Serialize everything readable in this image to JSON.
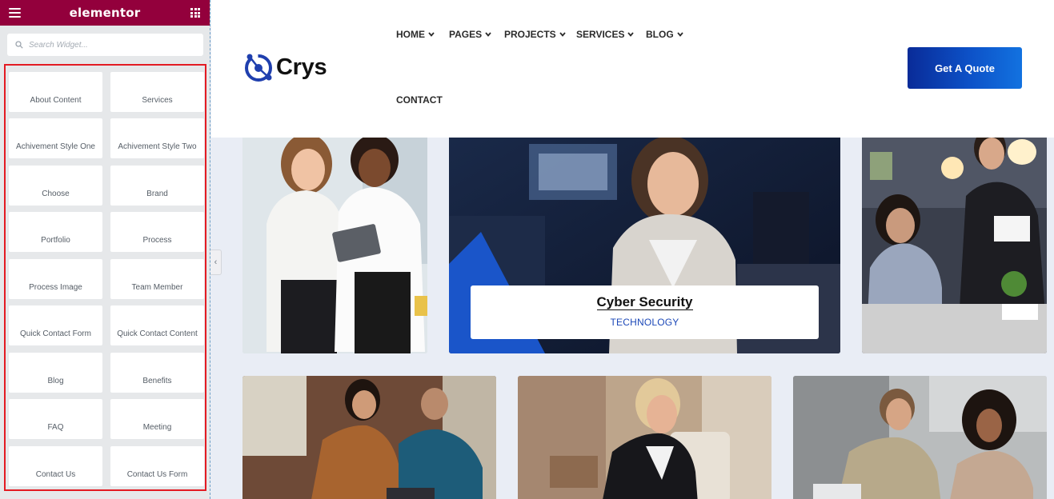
{
  "editor": {
    "brand": "elementor",
    "search": {
      "placeholder": "Search Widget..."
    },
    "widgets": [
      "About Content",
      "Services",
      "Achivement Style One",
      "Achivement Style Two",
      "Choose",
      "Brand",
      "Portfolio",
      "Process",
      "Process Image",
      "Team Member",
      "Quick Contact Form",
      "Quick Contact Content",
      "Blog",
      "Benefits",
      "FAQ",
      "Meeting",
      "Contact Us",
      "Contact Us Form"
    ],
    "icons": {
      "menu": "hamburger-icon",
      "apps": "grid-icon",
      "search": "search-icon",
      "collapse": "chevron-left-icon"
    },
    "colors": {
      "topbar": "#93003c",
      "highlight_border": "#e31b23"
    }
  },
  "site": {
    "logo_text": "Crys",
    "nav": [
      {
        "label": "HOME",
        "dropdown": true
      },
      {
        "label": "PAGES",
        "dropdown": true
      },
      {
        "label": "PROJECTS",
        "dropdown": true
      },
      {
        "label": "SERVICES",
        "dropdown": true
      },
      {
        "label": "BLOG",
        "dropdown": true
      },
      {
        "label": "CONTACT",
        "dropdown": false
      }
    ],
    "cta_label": "Get A Quote",
    "featured": {
      "title": "Cyber Security",
      "category": "TECHNOLOGY"
    },
    "colors": {
      "accent": "#0d52c8",
      "category": "#1c48b8"
    }
  }
}
